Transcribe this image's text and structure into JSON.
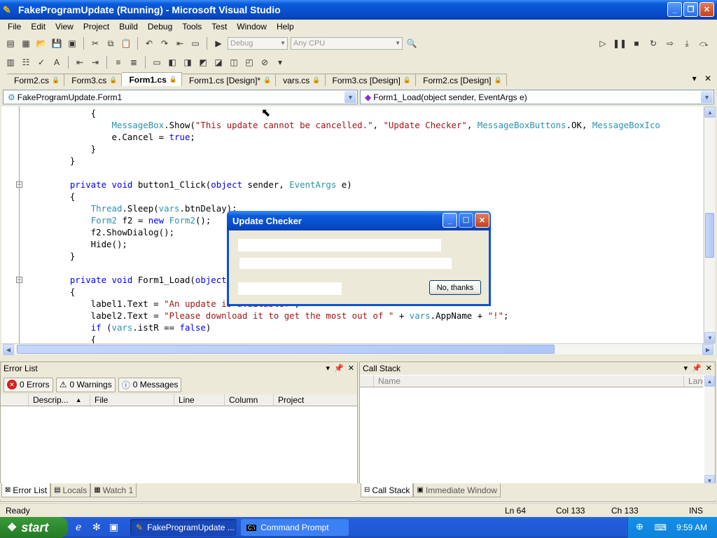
{
  "window": {
    "title": "FakeProgramUpdate (Running) - Microsoft Visual Studio",
    "accent": "#0A5BDB"
  },
  "menu": [
    "File",
    "Edit",
    "View",
    "Project",
    "Build",
    "Debug",
    "Tools",
    "Test",
    "Window",
    "Help"
  ],
  "toolbar": {
    "config_value": "Debug",
    "platform_value": "Any CPU"
  },
  "tabs": [
    "Form2.cs",
    "Form3.cs",
    "Form1.cs",
    "Form1.cs [Design]*",
    "vars.cs",
    "Form3.cs [Design]",
    "Form2.cs [Design]"
  ],
  "active_tab": "Form1.cs",
  "nav": {
    "class_value": "FakeProgramUpdate.Form1",
    "member_value": "Form1_Load(object sender, EventArgs e)"
  },
  "code": [
    "        {",
    "            MessageBox.Show(\"This update cannot be cancelled.\", \"Update Checker\", MessageBoxButtons.OK, MessageBoxIco",
    "            e.Cancel = true;",
    "        }",
    "    }",
    "",
    "    private void button1_Click(object sender, EventArgs e)",
    "    {",
    "        Thread.Sleep(vars.btnDelay);",
    "        Form2 f2 = new Form2();",
    "        f2.ShowDialog();",
    "        Hide();",
    "    }",
    "",
    "    private void Form1_Load(object sender, EventArgs e)",
    "    {",
    "        label1.Text = \"An update is available!\";",
    "        label2.Text = \"Please download it to get the most out of \" + vars.AppName + \"!\";",
    "        if (vars.istR == false)",
    "        {"
  ],
  "dialog": {
    "title": "Update Checker",
    "button_label": "No, thanks"
  },
  "error_list": {
    "title": "Error List",
    "errors": "0 Errors",
    "warnings": "0 Warnings",
    "messages": "0 Messages",
    "columns": [
      "Descrip...",
      "File",
      "Line",
      "Column",
      "Project"
    ]
  },
  "call_stack": {
    "title": "Call Stack",
    "columns": [
      "Name",
      "Lang"
    ]
  },
  "bottom_tabs_left": [
    "Error List",
    "Locals",
    "Watch 1"
  ],
  "bottom_tabs_right": [
    "Call Stack",
    "Immediate Window"
  ],
  "status": {
    "ready": "Ready",
    "ln": "Ln 64",
    "col": "Col 133",
    "ch": "Ch 133",
    "ins": "INS"
  },
  "taskbar": {
    "start": "start",
    "task1": "FakeProgramUpdate ...",
    "task2": "Command Prompt",
    "clock": "9:59 AM"
  }
}
